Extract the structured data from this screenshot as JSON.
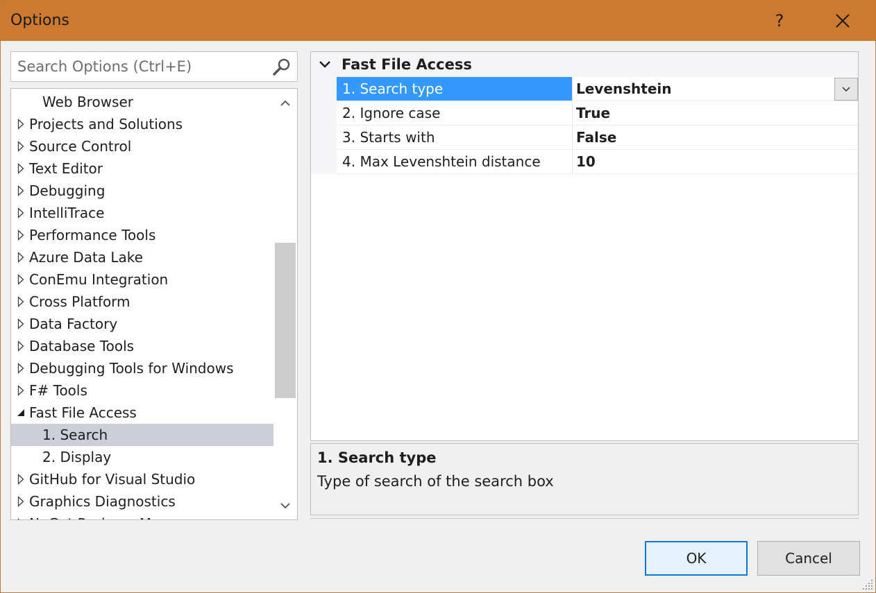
{
  "window": {
    "title": "Options",
    "help_label": "?"
  },
  "search": {
    "placeholder": "Search Options (Ctrl+E)"
  },
  "tree": {
    "items": [
      {
        "label": "Web Browser",
        "level": 1,
        "arrow": "none"
      },
      {
        "label": "Projects and Solutions",
        "level": 0,
        "arrow": "collapsed"
      },
      {
        "label": "Source Control",
        "level": 0,
        "arrow": "collapsed"
      },
      {
        "label": "Text Editor",
        "level": 0,
        "arrow": "collapsed"
      },
      {
        "label": "Debugging",
        "level": 0,
        "arrow": "collapsed"
      },
      {
        "label": "IntelliTrace",
        "level": 0,
        "arrow": "collapsed"
      },
      {
        "label": "Performance Tools",
        "level": 0,
        "arrow": "collapsed"
      },
      {
        "label": "Azure Data Lake",
        "level": 0,
        "arrow": "collapsed"
      },
      {
        "label": "ConEmu Integration",
        "level": 0,
        "arrow": "collapsed"
      },
      {
        "label": "Cross Platform",
        "level": 0,
        "arrow": "collapsed"
      },
      {
        "label": "Data Factory",
        "level": 0,
        "arrow": "collapsed"
      },
      {
        "label": "Database Tools",
        "level": 0,
        "arrow": "collapsed"
      },
      {
        "label": "Debugging Tools for Windows",
        "level": 0,
        "arrow": "collapsed"
      },
      {
        "label": "F# Tools",
        "level": 0,
        "arrow": "collapsed"
      },
      {
        "label": "Fast File Access",
        "level": 0,
        "arrow": "expanded"
      },
      {
        "label": "1. Search",
        "level": 1,
        "arrow": "none",
        "selected": true
      },
      {
        "label": "2. Display",
        "level": 1,
        "arrow": "none"
      },
      {
        "label": "GitHub for Visual Studio",
        "level": 0,
        "arrow": "collapsed"
      },
      {
        "label": "Graphics Diagnostics",
        "level": 0,
        "arrow": "collapsed"
      },
      {
        "label": "NuGet Package Manager",
        "level": 0,
        "arrow": "collapsed"
      }
    ]
  },
  "grid": {
    "category": "Fast File Access",
    "properties": [
      {
        "name": "1. Search type",
        "value": "Levenshtein",
        "selected": true,
        "dropdown": true
      },
      {
        "name": "2. Ignore case",
        "value": "True"
      },
      {
        "name": "3. Starts with",
        "value": "False"
      },
      {
        "name": "4. Max Levenshtein distance",
        "value": "10"
      }
    ]
  },
  "description": {
    "title": "1. Search type",
    "text": "Type of search of the search box"
  },
  "buttons": {
    "ok": "OK",
    "cancel": "Cancel"
  },
  "colors": {
    "titlebar": "#cc7a30",
    "selection_tree": "#ccced9",
    "selection_grid": "#3399ff",
    "focus_border": "#0078d7"
  }
}
